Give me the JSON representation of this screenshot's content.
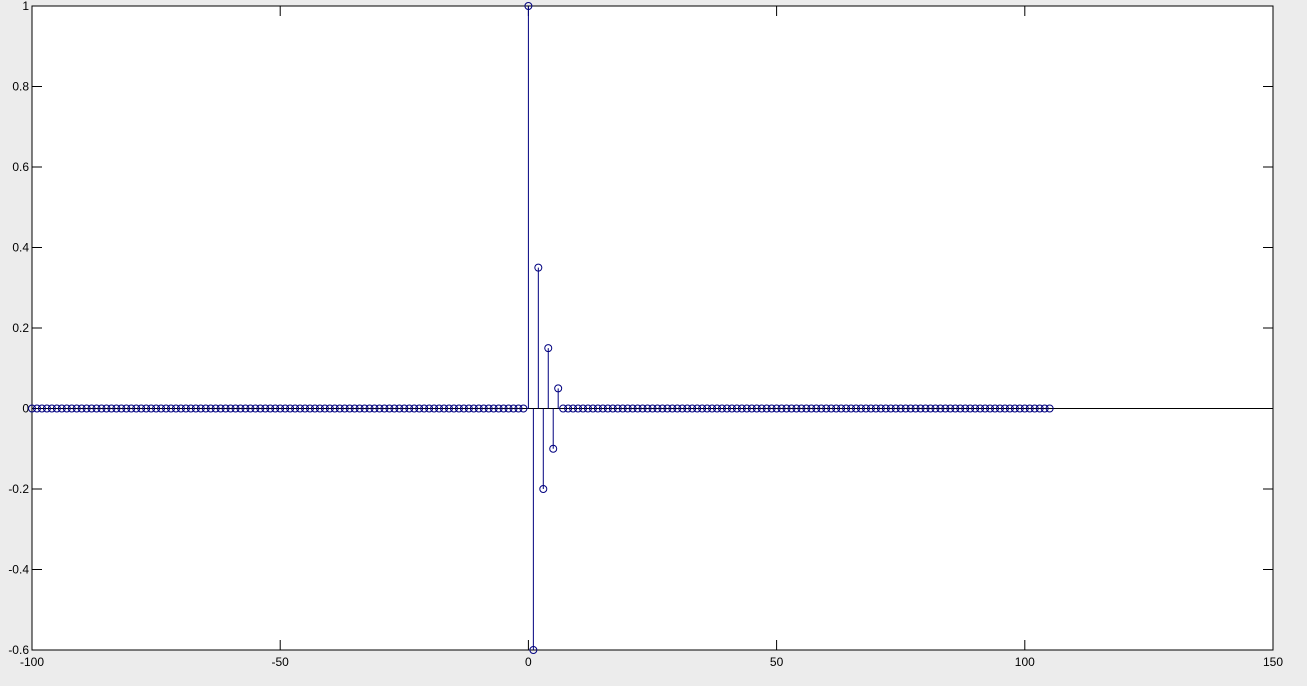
{
  "chart_data": {
    "type": "stem",
    "title": "",
    "xlabel": "",
    "ylabel": "",
    "xlim": [
      -100,
      150
    ],
    "ylim": [
      -0.6,
      1
    ],
    "grid": false,
    "x_ticks": [
      -100,
      -50,
      0,
      50,
      100,
      150
    ],
    "x_tick_labels": [
      "-100",
      "-50",
      "0",
      "50",
      "100",
      "150"
    ],
    "y_ticks": [
      -0.6,
      -0.4,
      -0.2,
      0,
      0.2,
      0.4,
      0.6,
      0.8,
      1
    ],
    "y_tick_labels": [
      "-0.6",
      "-0.4",
      "-0.2",
      "0",
      "0.2",
      "0.4",
      "0.6",
      "0.8",
      "1"
    ],
    "x_range": [
      -100,
      105
    ],
    "series": [
      {
        "marker": "o",
        "color": "#00007f",
        "baseline_color": "#000000",
        "nonzero_points": [
          {
            "x": 0,
            "y": 1
          },
          {
            "x": 1,
            "y": -0.6
          },
          {
            "x": 2,
            "y": 0.35
          },
          {
            "x": 3,
            "y": -0.2
          },
          {
            "x": 4,
            "y": 0.15
          },
          {
            "x": 5,
            "y": -0.1
          },
          {
            "x": 6,
            "y": 0.05
          }
        ],
        "default_value": 0
      }
    ]
  }
}
